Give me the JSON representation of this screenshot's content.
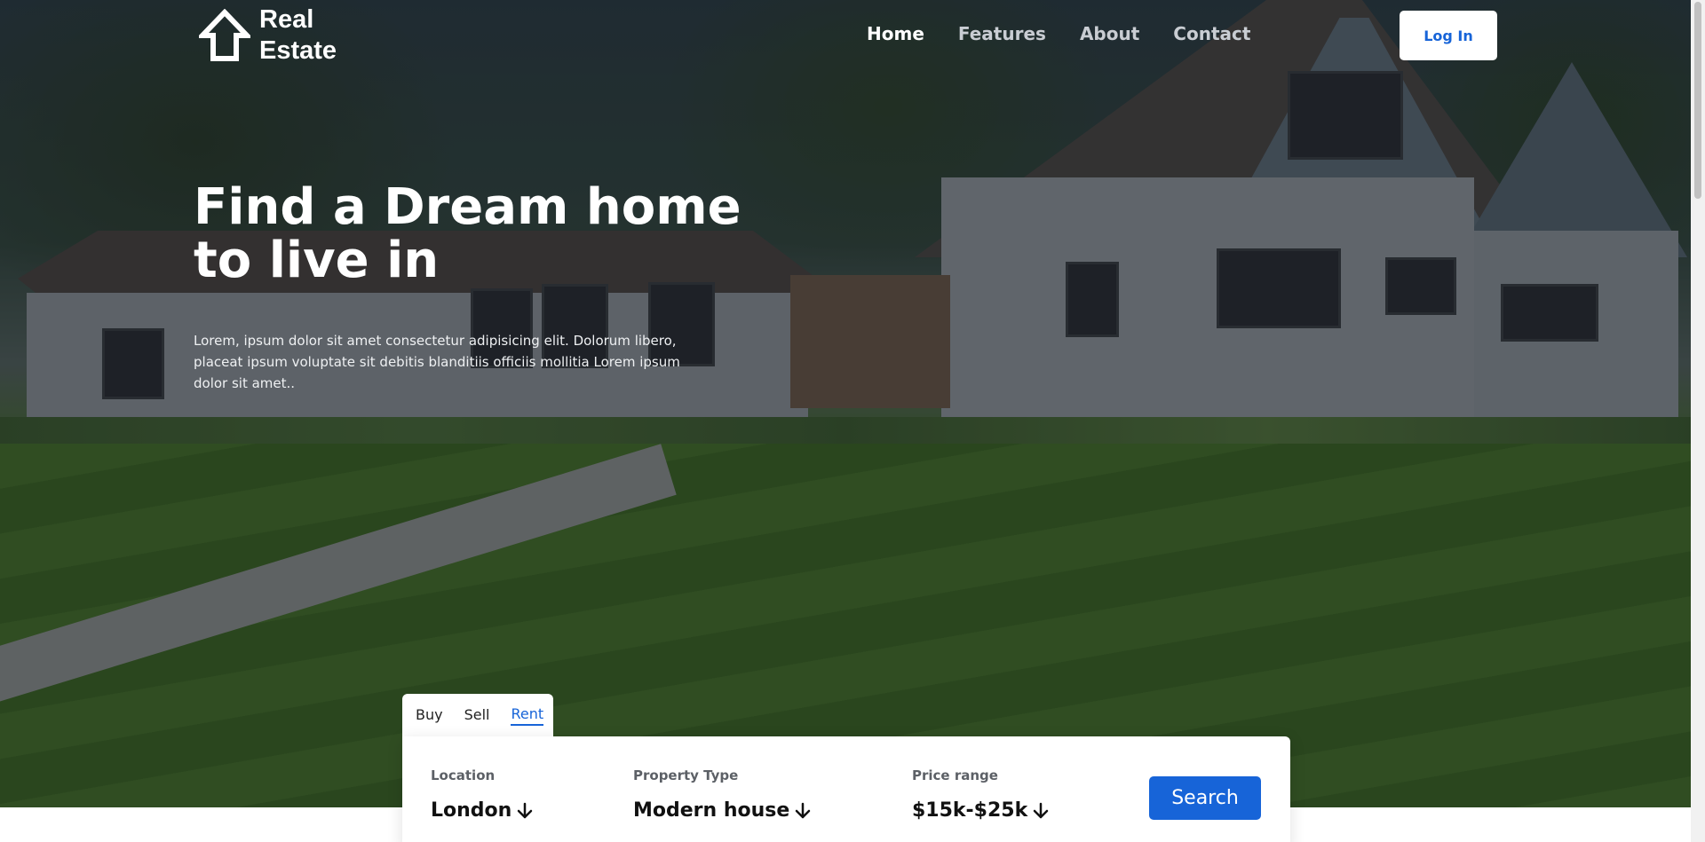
{
  "brand": {
    "line1": "Real",
    "line2": "Estate"
  },
  "nav": {
    "items": [
      {
        "label": "Home",
        "active": true
      },
      {
        "label": "Features",
        "active": false
      },
      {
        "label": "About",
        "active": false
      },
      {
        "label": "Contact",
        "active": false
      }
    ],
    "login_label": "Log In"
  },
  "hero": {
    "title": "Find a Dream home to live in",
    "description": "Lorem, ipsum dolor sit amet consectetur adipisicing elit. Dolorum libero, placeat ipsum voluptate sit debitis blanditiis officiis mollitia Lorem ipsum dolor sit amet.."
  },
  "search": {
    "tabs": [
      {
        "label": "Buy",
        "active": false
      },
      {
        "label": "Sell",
        "active": false
      },
      {
        "label": "Rent",
        "active": true
      }
    ],
    "location": {
      "label": "Location",
      "value": "London"
    },
    "property_type": {
      "label": "Property Type",
      "value": "Modern house"
    },
    "price_range": {
      "label": "Price range",
      "value": "$15k-$25k"
    },
    "button_label": "Search"
  },
  "colors": {
    "accent": "#1764d8",
    "white": "#ffffff"
  },
  "icons": {
    "logo": "house-arrow-icon",
    "dropdown": "arrow-down-icon"
  }
}
